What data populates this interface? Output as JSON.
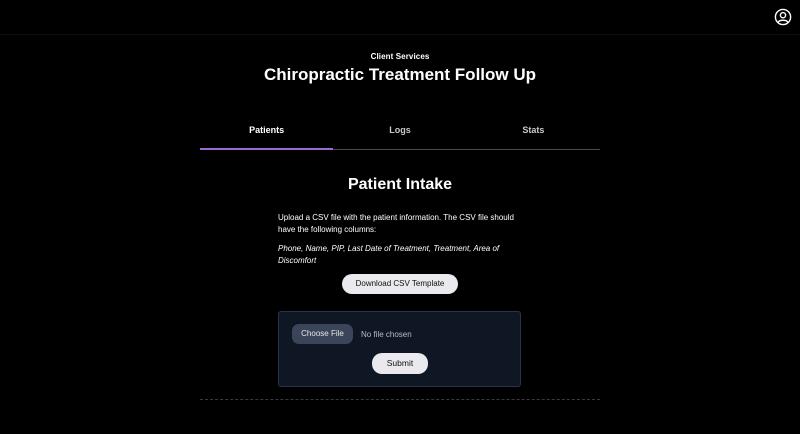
{
  "header": {
    "account_icon": "account-circle-icon"
  },
  "page": {
    "eyebrow": "Client Services",
    "title": "Chiropractic Treatment Follow Up"
  },
  "tabs": [
    {
      "label": "Patients",
      "active": true
    },
    {
      "label": "Logs",
      "active": false
    },
    {
      "label": "Stats",
      "active": false
    }
  ],
  "intake": {
    "title": "Patient Intake",
    "instructions": "Upload a CSV file with the patient information. The CSV file should have the following columns:",
    "columns": "Phone, Name, PIP, Last Date of Treatment, Treatment, Area of Discomfort",
    "download_label": "Download CSV Template",
    "choose_file_label": "Choose File",
    "file_status": "No file chosen",
    "submit_label": "Submit"
  },
  "colors": {
    "background": "#000000",
    "accent": "#9b6ad6",
    "panel": "#0f1624"
  }
}
